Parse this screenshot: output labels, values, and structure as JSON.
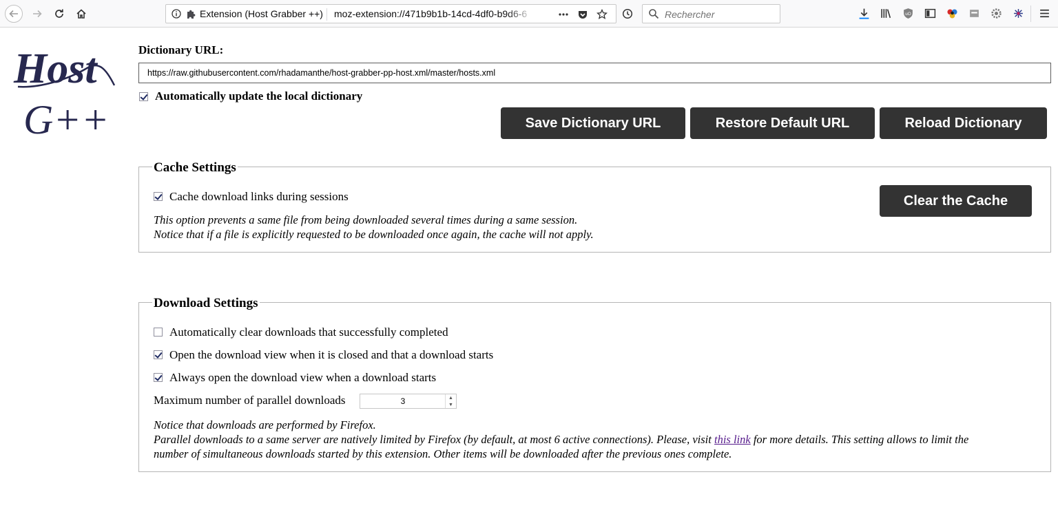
{
  "browser": {
    "identity_label": "Extension (Host Grabber ++)",
    "url": "moz-extension://471b9b1b-14cd-4df0-b9d6-6",
    "search_placeholder": "Rechercher"
  },
  "logo": {
    "line1": "Host",
    "line2": "G++"
  },
  "dictionary": {
    "label": "Dictionary URL:",
    "url_value": "https://raw.githubusercontent.com/rhadamanthe/host-grabber-pp-host.xml/master/hosts.xml",
    "auto_update_label": "Automatically update the local dictionary",
    "auto_update_checked": true,
    "buttons": {
      "save": "Save Dictionary URL",
      "restore": "Restore Default URL",
      "reload": "Reload Dictionary"
    }
  },
  "cache": {
    "legend": "Cache Settings",
    "option_label": "Cache download links during sessions",
    "option_checked": true,
    "note_line1": "This option prevents a same file from being downloaded several times during a same session.",
    "note_line2": "Notice that if a file is explicitly requested to be downloaded once again, the cache will not apply.",
    "clear_button": "Clear the Cache"
  },
  "downloads": {
    "legend": "Download Settings",
    "options": [
      {
        "label": "Automatically clear downloads that successfully completed",
        "checked": false
      },
      {
        "label": "Open the download view when it is closed and that a download starts",
        "checked": true
      },
      {
        "label": "Always open the download view when a download starts",
        "checked": true
      }
    ],
    "max_label": "Maximum number of parallel downloads",
    "max_value": "3",
    "note_line1": "Notice that downloads are performed by Firefox.",
    "note_line2_before": "Parallel downloads to a same server are natively limited by Firefox (by default, at most 6 active connections). Please, visit",
    "note_link": "this link",
    "note_line2_after": "for more details. This setting allows to limit the",
    "note_line3": "number of simultaneous downloads started by this extension. Other items will be downloaded after the previous ones complete."
  }
}
